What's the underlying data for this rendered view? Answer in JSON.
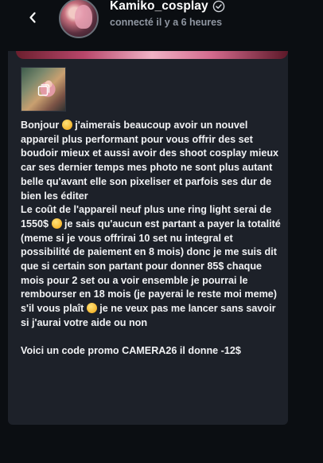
{
  "header": {
    "username": "Kamiko_cosplay",
    "status": "connecté il y a 6 heures",
    "back_icon": "chevron-left-icon",
    "verified_icon": "verified-check-icon"
  },
  "message": {
    "paragraphs": [
      [
        "Bonjour ",
        "emoji",
        " j'aimerais beaucoup avoir un nouvel appareil plus performant pour vous offrir des set boudoir mieux et aussi avoir des shoot cosplay mieux car ses dernier temps mes photo ne sont plus autant belle qu'avant elle son pixeliser et parfois ses dur de bien les éditer"
      ],
      [
        "Le coût de l'appareil neuf plus une ring light serai de 1550$ ",
        "emoji",
        " je sais qu'aucun est partant a payer la totalité (meme si je vous offrirai 10 set nu integral et possibilité de paiement en 8 mois) donc je me suis dit que si certain son partant pour donner 85$ chaque mois pour 2 set ou a voir ensemble je pourrai le rembourser en 18 mois (je payerai le reste moi meme) s'il vous plaît ",
        "emoji",
        " je ne veux pas me lancer sans savoir si j'aurai votre aide ou non"
      ],
      [
        "Voici un code promo CAMERA26 il donne -12$"
      ]
    ]
  },
  "colors": {
    "background": "#0b0e12",
    "card": "#1d2129",
    "text": "#f1f2f4",
    "muted": "#8f96a1"
  }
}
